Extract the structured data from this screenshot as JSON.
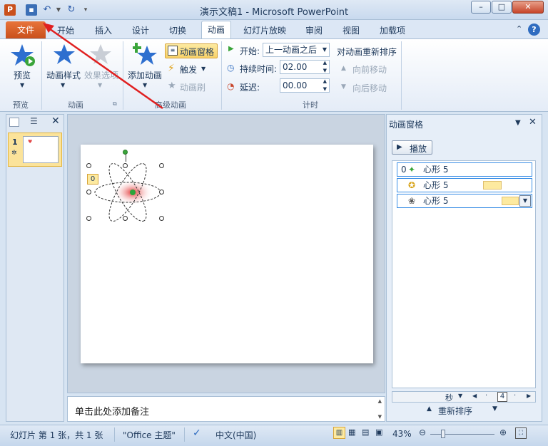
{
  "window": {
    "title": "演示文稿1 - Microsoft PowerPoint"
  },
  "tabs": {
    "file": "文件",
    "items": [
      "开始",
      "插入",
      "设计",
      "切换",
      "动画",
      "幻灯片放映",
      "审阅",
      "视图",
      "加载项"
    ]
  },
  "ribbon": {
    "preview": {
      "button": "预览",
      "group": "预览"
    },
    "animation": {
      "style_button": "动画样式",
      "effect_button": "效果选项",
      "group": "动画"
    },
    "advanced": {
      "add_button": "添加动画",
      "pane_button": "动画窗格",
      "trigger_button": "触发",
      "painter_button": "动画刷",
      "group": "高级动画"
    },
    "timing": {
      "start_label": "开始:",
      "start_value": "上一动画之后",
      "duration_label": "持续时间:",
      "duration_value": "02.00",
      "delay_label": "延迟:",
      "delay_value": "00.00",
      "reorder_title": "对动画重新排序",
      "move_earlier": "向前移动",
      "move_later": "向后移动",
      "group": "计时"
    }
  },
  "slides_panel": {
    "slide_number": "1"
  },
  "slide": {
    "animation_tag": "0"
  },
  "notes": {
    "placeholder": "单击此处添加备注"
  },
  "animation_pane": {
    "title": "动画窗格",
    "play_button": "播放",
    "items": [
      {
        "index": "0",
        "name": "心形 5"
      },
      {
        "index": "",
        "name": "心形 5"
      },
      {
        "index": "",
        "name": "心形 5"
      }
    ],
    "timeline_unit": "秒",
    "timeline_page": "4",
    "reorder_label": "重新排序"
  },
  "status": {
    "slide_info": "幻灯片 第 1 张，共 1 张",
    "theme": "\"Office 主题\"",
    "language": "中文(中国)",
    "zoom": "43%"
  },
  "colors": {
    "file_tab": "#d55a24",
    "accent": "#3a8ee6"
  }
}
